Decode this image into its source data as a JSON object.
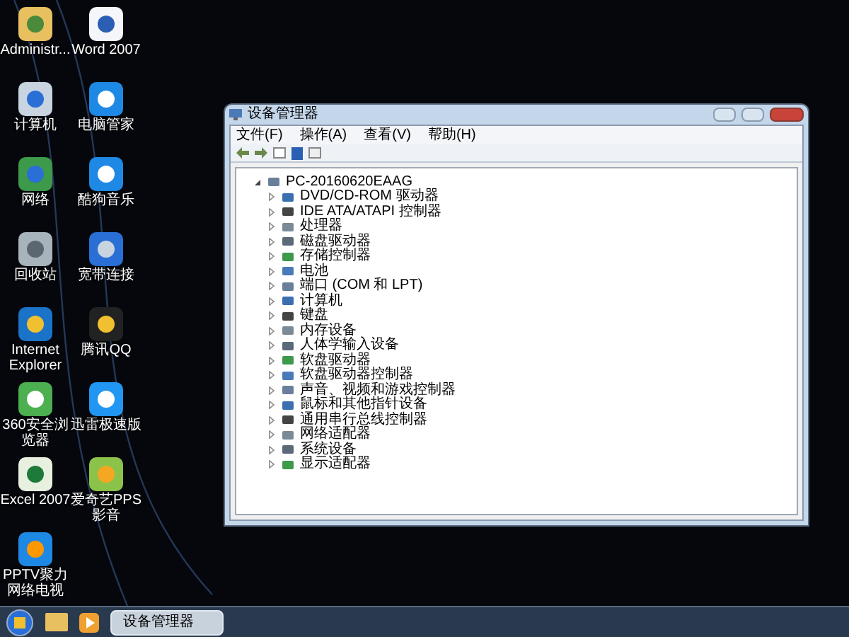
{
  "desktop_icons": [
    {
      "label": "Administr..."
    },
    {
      "label": "Word 2007"
    },
    {
      "label": "计算机"
    },
    {
      "label": "电脑管家"
    },
    {
      "label": "网络"
    },
    {
      "label": "酷狗音乐"
    },
    {
      "label": "回收站"
    },
    {
      "label": "宽带连接"
    },
    {
      "label": "Internet Explorer"
    },
    {
      "label": "腾讯QQ"
    },
    {
      "label": "360安全浏览器"
    },
    {
      "label": "迅雷极速版"
    },
    {
      "label": "Excel 2007"
    },
    {
      "label": "爱奇艺PPS影音"
    },
    {
      "label": "PPTV聚力网络电视"
    }
  ],
  "window": {
    "title": "设备管理器",
    "menu": [
      "文件(F)",
      "操作(A)",
      "查看(V)",
      "帮助(H)"
    ],
    "tree": {
      "label": "PC-20160620EAAG",
      "expanded": true,
      "children": [
        {
          "label": "DVD/CD-ROM 驱动器",
          "expanded": false
        },
        {
          "label": "IDE ATA/ATAPI 控制器",
          "expanded": false
        },
        {
          "label": "处理器",
          "expanded": false
        },
        {
          "label": "磁盘驱动器",
          "expanded": false
        },
        {
          "label": "存储控制器",
          "expanded": false
        },
        {
          "label": "电池",
          "expanded": false
        },
        {
          "label": "端口 (COM 和 LPT)",
          "expanded": false
        },
        {
          "label": "计算机",
          "expanded": false
        },
        {
          "label": "键盘",
          "expanded": false
        },
        {
          "label": "内存设备",
          "expanded": false
        },
        {
          "label": "人体学输入设备",
          "expanded": false
        },
        {
          "label": "软盘驱动器",
          "expanded": false
        },
        {
          "label": "软盘驱动器控制器",
          "expanded": false
        },
        {
          "label": "声音、视频和游戏控制器",
          "expanded": false
        },
        {
          "label": "鼠标和其他指针设备",
          "expanded": false
        },
        {
          "label": "通用串行总线控制器",
          "expanded": false
        },
        {
          "label": "网络适配器",
          "expanded": false
        },
        {
          "label": "系统设备",
          "expanded": false
        },
        {
          "label": "显示适配器",
          "expanded": false
        }
      ]
    }
  },
  "taskbar": {
    "tasks": [
      {
        "label": "设备管理器",
        "selected": true
      }
    ]
  }
}
